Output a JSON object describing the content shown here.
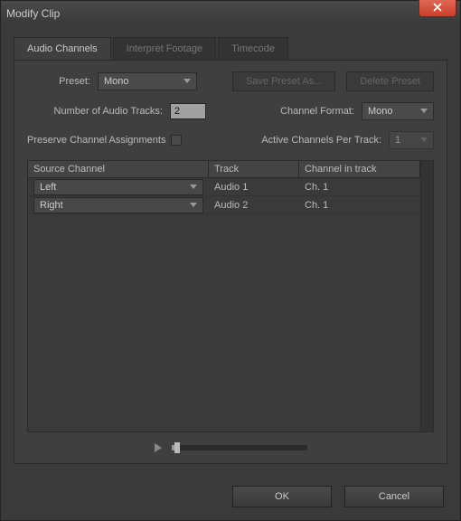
{
  "window": {
    "title": "Modify Clip"
  },
  "tabs": [
    {
      "label": "Audio Channels"
    },
    {
      "label": "Interpret Footage"
    },
    {
      "label": "Timecode"
    }
  ],
  "preset": {
    "label": "Preset:",
    "value": "Mono",
    "save_btn": "Save Preset As...",
    "delete_btn": "Delete Preset"
  },
  "tracks": {
    "label": "Number of Audio Tracks:",
    "value": "2"
  },
  "format": {
    "label": "Channel Format:",
    "value": "Mono"
  },
  "preserve": {
    "label": "Preserve Channel Assignments"
  },
  "active": {
    "label": "Active Channels Per Track:",
    "value": "1"
  },
  "table": {
    "headers": {
      "source": "Source Channel",
      "track": "Track",
      "chan": "Channel in track"
    },
    "rows": [
      {
        "source": "Left",
        "track": "Audio 1",
        "chan": "Ch. 1"
      },
      {
        "source": "Right",
        "track": "Audio 2",
        "chan": "Ch. 1"
      }
    ]
  },
  "footer": {
    "ok": "OK",
    "cancel": "Cancel"
  }
}
